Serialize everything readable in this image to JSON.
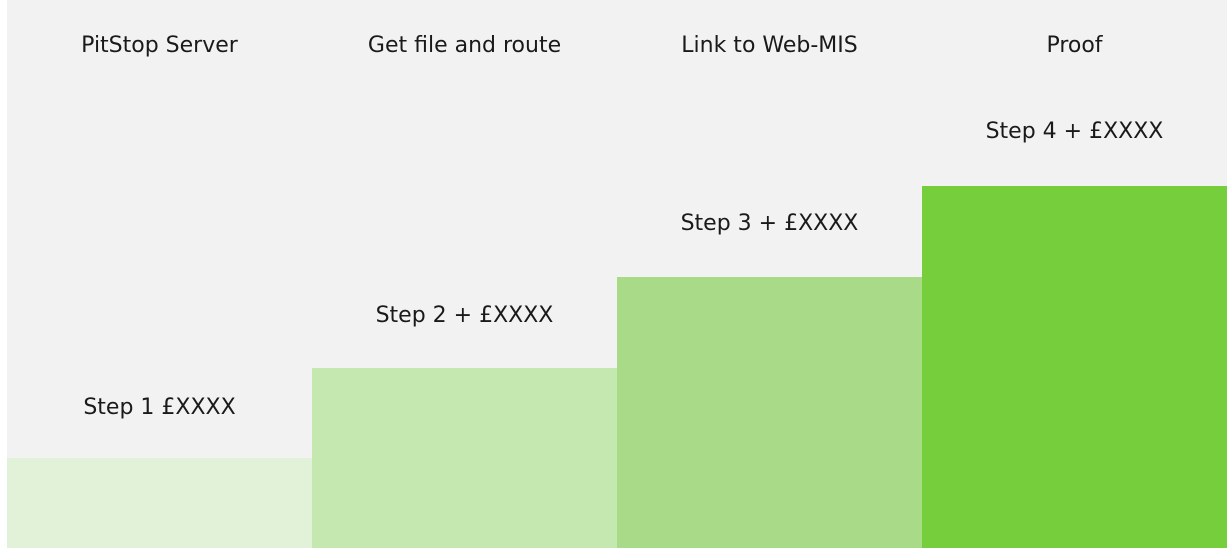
{
  "columns": [
    {
      "header": "PitStop Server",
      "step": "Step 1 £XXXX",
      "color": "#e1f2d8"
    },
    {
      "header": "Get file and route",
      "step": "Step 2 + £XXXX",
      "color": "#c5e7b0"
    },
    {
      "header": "Link to Web-MIS",
      "step": "Step 3 + £XXXX",
      "color": "#a8da87"
    },
    {
      "header": "Proof",
      "step": "Step 4 + £XXXX",
      "color": "#76ce3c"
    }
  ],
  "colors": {
    "background": "#f2f2f2",
    "text": "#1a1a1a"
  }
}
